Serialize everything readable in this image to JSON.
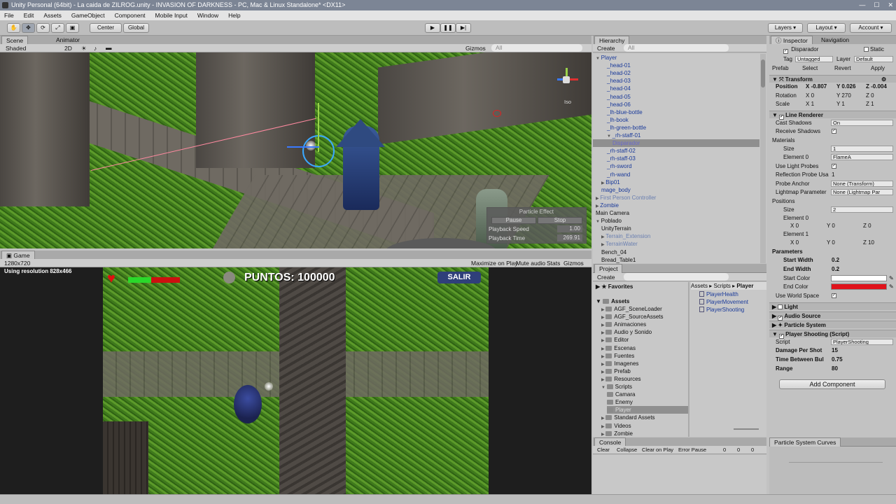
{
  "window": {
    "title": "Unity Personal (64bit) - La caida de ZILROG.unity - INVASION OF DARKNESS - PC, Mac & Linux Standalone* <DX11>"
  },
  "menu": [
    "File",
    "Edit",
    "Assets",
    "GameObject",
    "Component",
    "Mobile Input",
    "Window",
    "Help"
  ],
  "toolbar": {
    "pivot": "Center",
    "space": "Global",
    "layers": "Layers",
    "layout": "Layout",
    "account": "Account"
  },
  "scene": {
    "tabs": [
      "Scene",
      "Animator"
    ],
    "shading": "Shaded",
    "mode2d": "2D",
    "gizmos": "Gizmos",
    "search": "All",
    "persp": "Iso",
    "particle": {
      "title": "Particle Effect",
      "pause": "Pause",
      "stop": "Stop",
      "speed_label": "Playback Speed",
      "speed": "1.00",
      "time_label": "Playback Time",
      "time": "269.91"
    }
  },
  "game": {
    "tab": "Game",
    "res": "1280x720",
    "using": "Using resolution 828x466",
    "maximize": "Maximize on Play",
    "mute": "Mute audio",
    "stats": "Stats",
    "gizmos": "Gizmos",
    "score": "PUNTOS: 100000",
    "exit": "SALIR",
    "health_fraction": 0.45
  },
  "hierarchy": {
    "tab": "Hierarchy",
    "create": "Create",
    "search": "All",
    "items": [
      {
        "label": "Player",
        "d": 0,
        "arrow": "▼",
        "c": "b"
      },
      {
        "label": "_head-01",
        "d": 2,
        "c": "b"
      },
      {
        "label": "_head-02",
        "d": 2,
        "c": "b"
      },
      {
        "label": "_head-03",
        "d": 2,
        "c": "b"
      },
      {
        "label": "_head-04",
        "d": 2,
        "c": "b"
      },
      {
        "label": "_head-05",
        "d": 2,
        "c": "b"
      },
      {
        "label": "_head-06",
        "d": 2,
        "c": "b"
      },
      {
        "label": "_lh-blue-bottle",
        "d": 2,
        "c": "b"
      },
      {
        "label": "_lh-book",
        "d": 2,
        "c": "b"
      },
      {
        "label": "_lh-green-bottle",
        "d": 2,
        "c": "b"
      },
      {
        "label": "_rh-staff-01",
        "d": 2,
        "arrow": "▼",
        "c": "b"
      },
      {
        "label": "Disparador",
        "d": 3,
        "c": "s"
      },
      {
        "label": "_rh-staff-02",
        "d": 2,
        "c": "b"
      },
      {
        "label": "_rh-staff-03",
        "d": 2,
        "c": "b"
      },
      {
        "label": "_rh-sword",
        "d": 2,
        "c": "b"
      },
      {
        "label": "_rh-wand",
        "d": 2,
        "c": "b"
      },
      {
        "label": "Bip01",
        "d": 1,
        "arrow": "▶",
        "c": "b"
      },
      {
        "label": "mage_body",
        "d": 1,
        "c": "b"
      },
      {
        "label": "First Person Controller",
        "d": 0,
        "arrow": "▶",
        "c": "g"
      },
      {
        "label": "Zombie",
        "d": 0,
        "arrow": "▶",
        "c": "b"
      },
      {
        "label": "Main Camera",
        "d": 0,
        "c": "k"
      },
      {
        "label": "Poblado",
        "d": 0,
        "arrow": "▼",
        "c": "k"
      },
      {
        "label": "UnityTerrain",
        "d": 1,
        "c": "k"
      },
      {
        "label": "Terrain_Extension",
        "d": 1,
        "arrow": "▶",
        "c": "g"
      },
      {
        "label": "TerrainWater",
        "d": 1,
        "arrow": "▶",
        "c": "g"
      },
      {
        "label": "Bench_04",
        "d": 1,
        "c": "k"
      },
      {
        "label": "Bread_Table1",
        "d": 1,
        "c": "k"
      }
    ]
  },
  "project": {
    "tab": "Project",
    "create": "Create",
    "favorites": "Favorites",
    "assets": "Assets",
    "breadcrumb": [
      "Assets",
      "Scripts",
      "Player"
    ],
    "tree": [
      {
        "label": "AGF_SceneLoader",
        "d": 1
      },
      {
        "label": "AGF_SourceAssets",
        "d": 1
      },
      {
        "label": "Animaciones",
        "d": 1
      },
      {
        "label": "Audio y Sonido",
        "d": 1
      },
      {
        "label": "Editor",
        "d": 1
      },
      {
        "label": "Escenas",
        "d": 1
      },
      {
        "label": "Fuentes",
        "d": 1
      },
      {
        "label": "Imagenes",
        "d": 1
      },
      {
        "label": "Prefab",
        "d": 1
      },
      {
        "label": "Resources",
        "d": 1
      },
      {
        "label": "Scripts",
        "d": 1
      },
      {
        "label": "Camara",
        "d": 2
      },
      {
        "label": "Enemy",
        "d": 2
      },
      {
        "label": "Player",
        "d": 2,
        "sel": true
      },
      {
        "label": "Standard Assets",
        "d": 1
      },
      {
        "label": "Videos",
        "d": 1
      },
      {
        "label": "Zombie",
        "d": 1
      }
    ],
    "files": [
      "PlayerHealth",
      "PlayerMovement",
      "PlayerShooting"
    ]
  },
  "console": {
    "tab": "Console",
    "clear": "Clear",
    "collapse": "Collapse",
    "clear_on_play": "Clear on Play",
    "error_pause": "Error Pause",
    "counts": [
      "0",
      "0",
      "0"
    ]
  },
  "curves": {
    "tab": "Particle System Curves"
  },
  "inspector": {
    "tabs": [
      "Inspector",
      "Navigation"
    ],
    "object": "Disparador",
    "static": "Static",
    "tag_label": "Tag",
    "tag": "Untagged",
    "layer_label": "Layer",
    "layer": "Default",
    "prefab": "Prefab",
    "select": "Select",
    "revert": "Revert",
    "apply": "Apply",
    "transform": {
      "title": "Transform",
      "position": "Position",
      "rotation": "Rotation",
      "scale": "Scale",
      "pos": [
        "-0.807",
        "0.026",
        "-0.004"
      ],
      "rot": [
        "0",
        "270",
        "0"
      ],
      "scl": [
        "1",
        "1",
        "1"
      ]
    },
    "line": {
      "title": "Line Renderer",
      "cast": "Cast Shadows",
      "cast_v": "On",
      "receive": "Receive Shadows",
      "materials": "Materials",
      "size": "Size",
      "size_v": "1",
      "el0": "Element 0",
      "el0_v": "FlameA",
      "probes": "Use Light Probes",
      "refl": "Reflection Probe Usa",
      "refl_v": "1",
      "anchor": "Probe Anchor",
      "anchor_v": "None (Transform)",
      "lightmap": "Lightmap Parameter",
      "lightmap_v": "None (Lightmap Par",
      "positions": "Positions",
      "psize": "Size",
      "psize_v": "2",
      "pe0": "Element 0",
      "pe1": "Element 1",
      "p0": [
        "0",
        "0",
        "0"
      ],
      "p1": [
        "0",
        "0",
        "10"
      ],
      "params": "Parameters",
      "sw": "Start Width",
      "sw_v": "0.2",
      "ew": "End Width",
      "ew_v": "0.2",
      "sc": "Start Color",
      "ec": "End Color",
      "world": "Use World Space"
    },
    "light": "Light",
    "audio": "Audio Source",
    "particle": "Particle System",
    "script": {
      "title": "Player Shooting (Script)",
      "script": "Script",
      "script_v": "PlayerShooting",
      "dmg": "Damage Per Shot",
      "dmg_v": "15",
      "tbb": "Time Between Bul",
      "tbb_v": "0.75",
      "range": "Range",
      "range_v": "80"
    },
    "add": "Add Component"
  },
  "colors": {
    "start_color": "#ffffff",
    "end_color": "#e0121a",
    "accent": "#1a3a9a"
  }
}
